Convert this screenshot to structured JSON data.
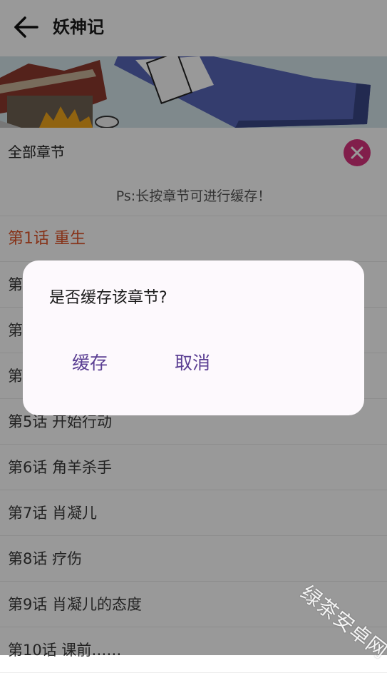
{
  "header": {
    "title": "妖神记"
  },
  "panel": {
    "title": "全部章节",
    "tip": "Ps:长按章节可进行缓存！"
  },
  "chapters": [
    {
      "label": "第1话 重生",
      "active": true
    },
    {
      "label": "第2话 ...",
      "active": false
    },
    {
      "label": "第3话 ...",
      "active": false
    },
    {
      "label": "第4话 ...",
      "active": false
    },
    {
      "label": "第5话 开始行动",
      "active": false
    },
    {
      "label": "第6话 角羊杀手",
      "active": false
    },
    {
      "label": "第7话 肖凝儿",
      "active": false
    },
    {
      "label": "第8话 疗伤",
      "active": false
    },
    {
      "label": "第9话 肖凝儿的态度",
      "active": false
    },
    {
      "label": "第10话 课前……",
      "active": false
    }
  ],
  "dialog": {
    "message": "是否缓存该章节?",
    "confirm": "缓存",
    "cancel": "取消"
  },
  "watermark": "绿茶安卓网",
  "colors": {
    "accent_active": "#e0562b",
    "close_button": "#d8337d",
    "dialog_button": "#5b3f93"
  }
}
